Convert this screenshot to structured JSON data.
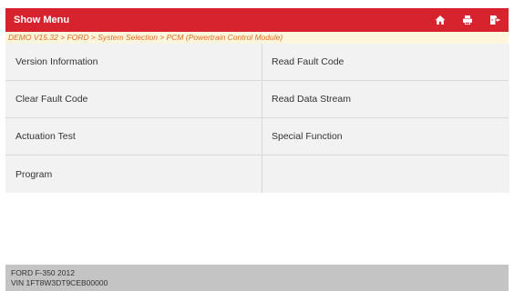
{
  "header": {
    "title": "Show Menu",
    "icons": [
      "home-icon",
      "print-icon",
      "exit-icon"
    ]
  },
  "breadcrumb": "DEMO V15.32 > FORD > System Selection > PCM (Powertrain Control Module)",
  "menu": {
    "items": [
      "Version Information",
      "Read Fault Code",
      "Clear Fault Code",
      "Read Data Stream",
      "Actuation Test",
      "Special Function",
      "Program",
      ""
    ]
  },
  "footer": {
    "vehicle": "FORD F-350 2012",
    "vin": "VIN 1FT8W3DT9CEB00000"
  },
  "colors": {
    "header_bg": "#d7232e",
    "breadcrumb_text": "#e06b1f",
    "breadcrumb_bg": "#fdf6dc",
    "cell_bg": "#f2f2f2",
    "footer_bg": "#c4c4c4"
  }
}
